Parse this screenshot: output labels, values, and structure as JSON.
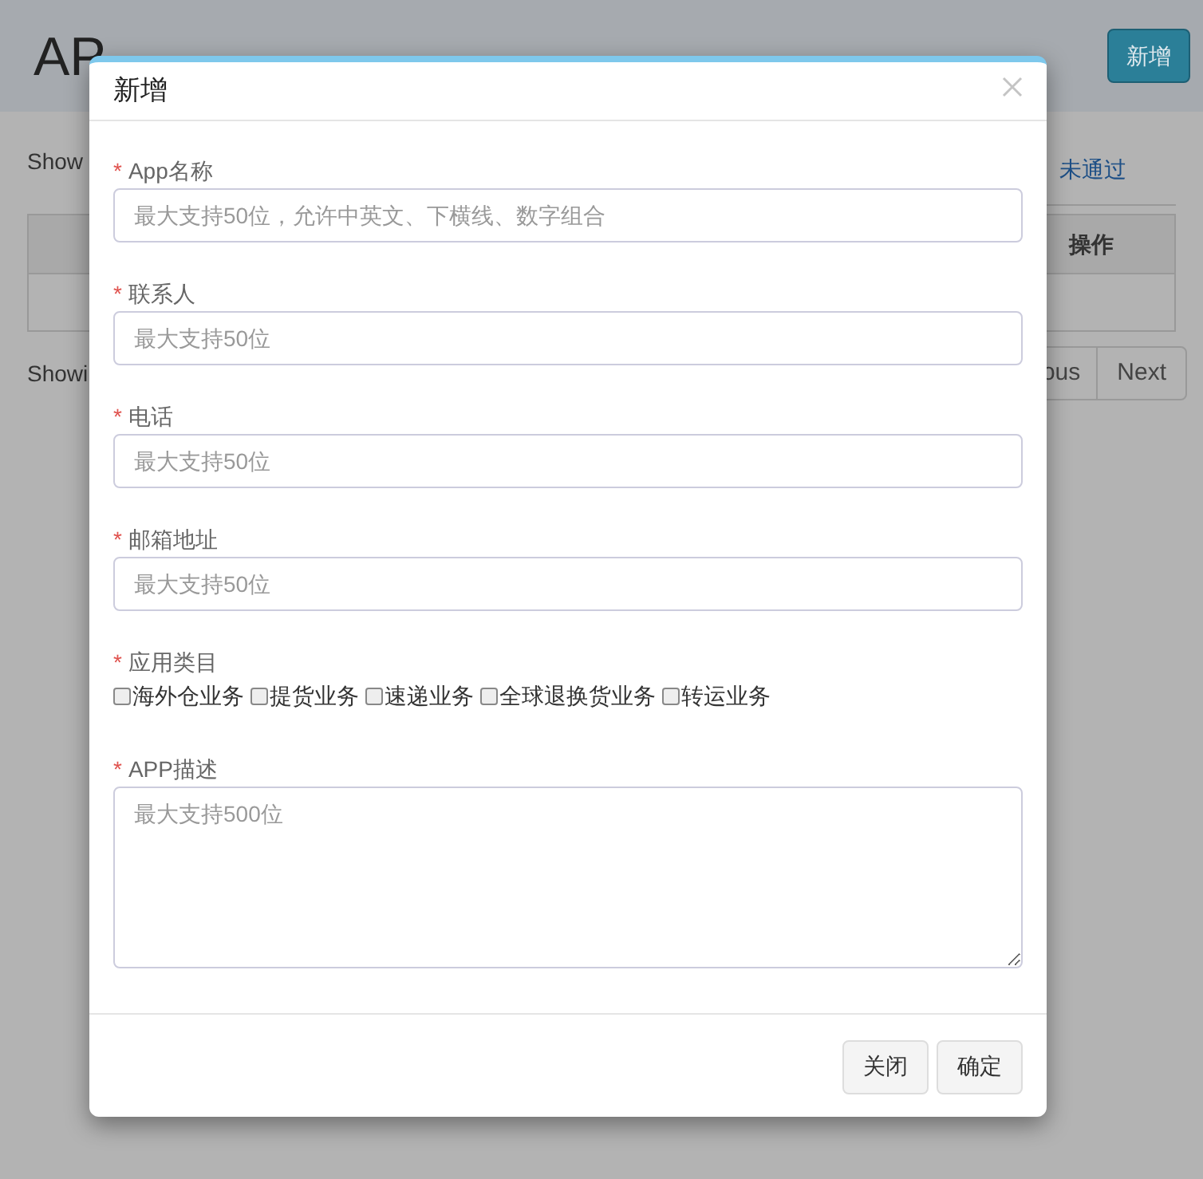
{
  "page": {
    "title": "AP",
    "add_button": "新增",
    "show_text": "Show",
    "tab_link": "未通过",
    "table": {
      "columns": [
        "操作"
      ]
    },
    "info_text": "Showi",
    "pagination": [
      "ous",
      "Next"
    ]
  },
  "modal": {
    "title": "新增",
    "fields": [
      {
        "kind": "text",
        "required_mark": "*",
        "label": "App名称",
        "placeholder": "最大支持50位，允许中英文、下横线、数字组合"
      },
      {
        "kind": "text",
        "required_mark": "*",
        "label": "联系人",
        "placeholder": "最大支持50位"
      },
      {
        "kind": "text",
        "required_mark": "*",
        "label": "电话",
        "placeholder": "最大支持50位"
      },
      {
        "kind": "text",
        "required_mark": "*",
        "label": "邮箱地址",
        "placeholder": "最大支持50位"
      },
      {
        "kind": "checkboxes",
        "required_mark": "*",
        "label": "应用类目",
        "options": [
          {
            "label": "海外仓业务",
            "checked": false
          },
          {
            "label": "提货业务",
            "checked": false
          },
          {
            "label": "速递业务",
            "checked": false
          },
          {
            "label": "全球退换货业务",
            "checked": false
          },
          {
            "label": "转运业务",
            "checked": false
          }
        ]
      },
      {
        "kind": "textarea",
        "required_mark": "*",
        "label": "APP描述",
        "placeholder": "最大支持500位"
      }
    ],
    "buttons": [
      "关闭",
      "确定"
    ]
  }
}
